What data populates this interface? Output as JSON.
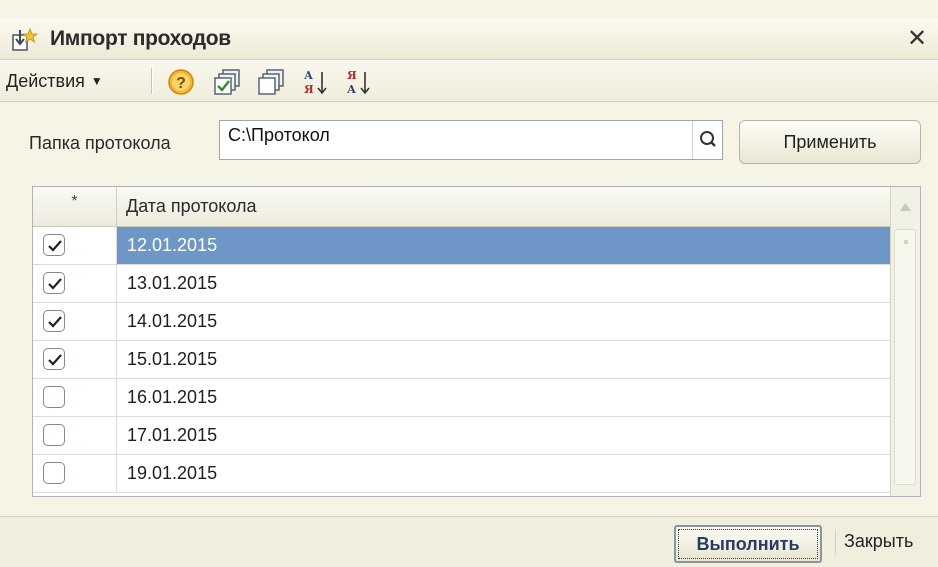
{
  "window": {
    "title": "Импорт проходов",
    "close_glyph": "✕",
    "title_icon": "import-document-icon"
  },
  "toolbar": {
    "actions_label": "Действия",
    "buttons": [
      {
        "icon": "help-icon"
      },
      {
        "icon": "check-all-icon"
      },
      {
        "icon": "uncheck-all-icon"
      },
      {
        "icon": "sort-ascending-icon"
      },
      {
        "icon": "sort-descending-icon"
      }
    ]
  },
  "folder": {
    "label": "Папка протокола",
    "value": "C:\\Протокол",
    "apply_label": "Применить"
  },
  "table": {
    "columns": [
      "*",
      "Дата протокола"
    ],
    "rows": [
      {
        "checked": true,
        "date": "12.01.2015",
        "selected": true
      },
      {
        "checked": true,
        "date": "13.01.2015"
      },
      {
        "checked": true,
        "date": "14.01.2015"
      },
      {
        "checked": true,
        "date": "15.01.2015"
      },
      {
        "checked": false,
        "date": "16.01.2015"
      },
      {
        "checked": false,
        "date": "17.01.2015"
      },
      {
        "checked": false,
        "date": "19.01.2015"
      }
    ]
  },
  "footer": {
    "run_label": "Выполнить",
    "close_label": "Закрыть"
  },
  "colors": {
    "selection": "#6e97c8",
    "window_bg": "#f6f4e4"
  }
}
